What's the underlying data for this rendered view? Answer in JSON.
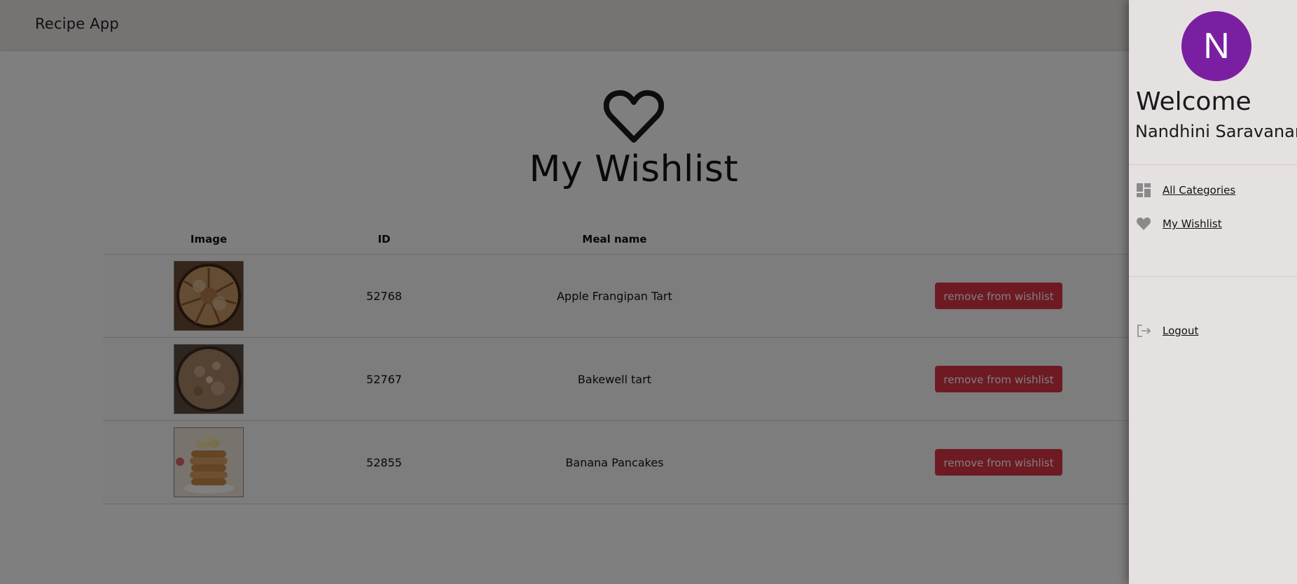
{
  "header": {
    "brand": "Recipe App"
  },
  "page": {
    "title": "My Wishlist"
  },
  "table": {
    "columns": [
      "Image",
      "ID",
      "Meal name",
      ""
    ],
    "rows": [
      {
        "id": "52768",
        "meal_name": "Apple Frangipan Tart",
        "action": "remove from wishlist",
        "image": "apple-frangipan-tart-photo"
      },
      {
        "id": "52767",
        "meal_name": "Bakewell tart",
        "action": "remove from wishlist",
        "image": "bakewell-tart-photo"
      },
      {
        "id": "52855",
        "meal_name": "Banana Pancakes",
        "action": "remove from wishlist",
        "image": "banana-pancakes-photo"
      }
    ]
  },
  "drawer": {
    "avatar_letter": "N",
    "welcome": "Welcome",
    "user_name": "Nandhini Saravanan",
    "nav": [
      {
        "label": "All Categories",
        "icon": "dashboard-icon"
      },
      {
        "label": "My Wishlist",
        "icon": "heart-icon"
      }
    ],
    "logout": {
      "label": "Logout",
      "icon": "logout-icon"
    }
  },
  "colors": {
    "accent_danger": "#dc3545",
    "avatar_bg": "#7b1fa2",
    "header_bg": "#ece6e7",
    "drawer_bg": "#e6e1e1",
    "backdrop": "rgba(0,0,0,0.5)"
  }
}
